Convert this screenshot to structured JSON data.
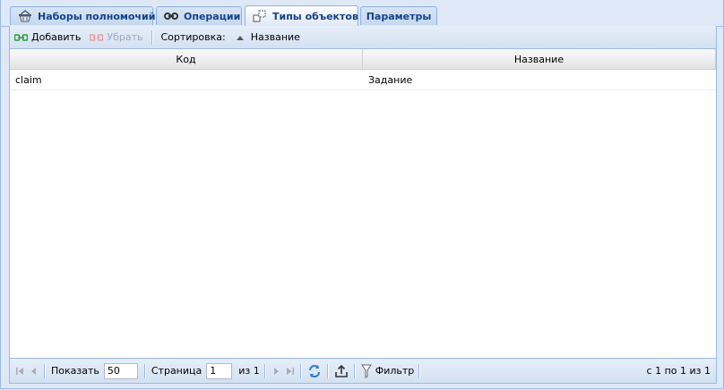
{
  "tabs": [
    {
      "label": "Наборы полномочий",
      "icon": "basket-icon",
      "active": false
    },
    {
      "label": "Операции",
      "icon": "link-icon",
      "active": false
    },
    {
      "label": "Типы объектов",
      "icon": "object-types-icon",
      "active": true
    },
    {
      "label": "Параметры",
      "icon": "",
      "active": false
    }
  ],
  "toolbar": {
    "add_label": "Добавить",
    "remove_label": "Убрать",
    "sort_label": "Сортировка:",
    "sort_field": "Название"
  },
  "grid": {
    "columns": [
      "Код",
      "Название"
    ],
    "rows": [
      {
        "code": "claim",
        "name": "Задание"
      }
    ]
  },
  "pager": {
    "show_label": "Показать",
    "page_size": "50",
    "page_label": "Страница",
    "page_value": "1",
    "of_label": "из 1",
    "filter_label": "Фильтр",
    "summary": "с 1 по 1 из 1"
  },
  "colors": {
    "accent": "#15428b",
    "border": "#99bbe8",
    "background": "#dfe8f6"
  }
}
